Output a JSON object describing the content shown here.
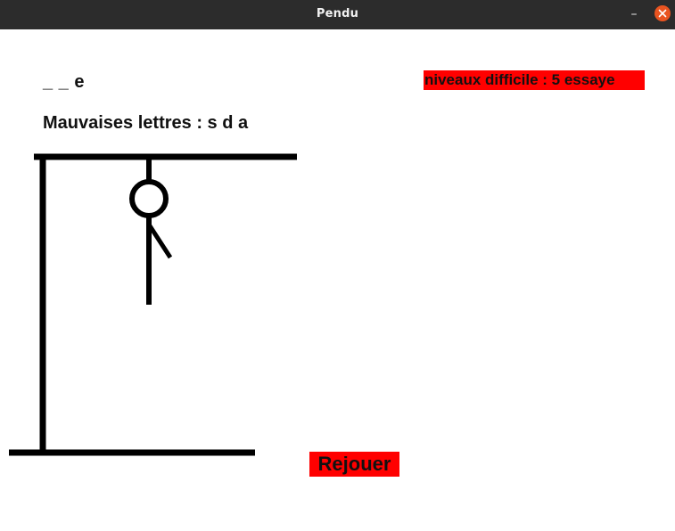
{
  "window": {
    "title": "Pendu",
    "minimize_label": "–"
  },
  "game": {
    "word_display": "_ _ e",
    "wrong_letters": "Mauvaises lettres : s d a",
    "level": "niveaux difficile : 5 essaye",
    "replay_label": "Rejouer"
  }
}
